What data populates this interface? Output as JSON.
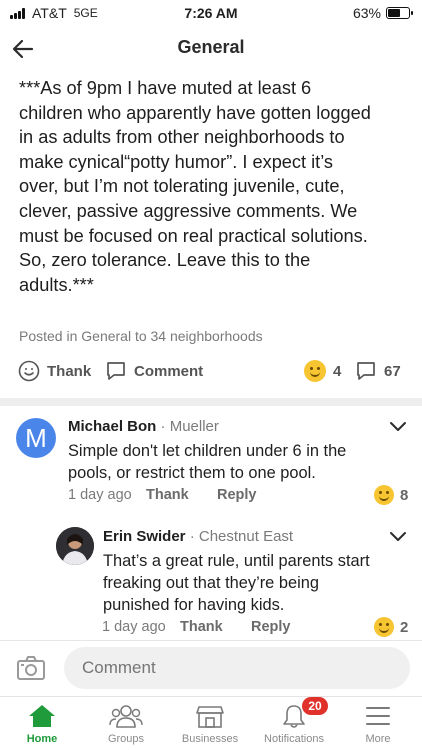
{
  "status_bar": {
    "carrier": "AT&T",
    "network": "5GE",
    "time": "7:26 AM",
    "battery": "63%",
    "battery_level": 0.63
  },
  "header": {
    "title": "General"
  },
  "post": {
    "text": "***As of 9pm I have muted at least 6\nchildren who apparently have gotten logged\nin as adults from other neighborhoods to\nmake cynical“potty humor”.  I expect it’s\nover, but I’m not tolerating juvenile, cute,\nclever, passive aggressive comments. We\nmust be focused on real practical solutions.\nSo, zero tolerance. Leave this to the\nadults.***",
    "meta": "Posted in General to 34 neighborhoods",
    "thank_label": "Thank",
    "comment_label": "Comment",
    "reaction_count": "4",
    "comment_count": "67"
  },
  "comments": [
    {
      "avatar_letter": "M",
      "avatar_color": "#4a86ea",
      "name": "Michael Bon",
      "neighborhood": "· Mueller",
      "body": "Simple don't let children under 6 in the\npools, or restrict them to one pool.",
      "time": "1 day ago",
      "thank_label": "Thank",
      "reply_label": "Reply",
      "reaction_count": "8"
    },
    {
      "name": "Erin Swider",
      "neighborhood": "· Chestnut East",
      "body": "That’s a great rule, until parents start\nfreaking out that they’re being\npunished for having kids.",
      "time": "1 day ago",
      "thank_label": "Thank",
      "reply_label": "Reply",
      "reaction_count": "2"
    }
  ],
  "composer": {
    "placeholder": "Comment"
  },
  "tabbar": {
    "tabs": [
      {
        "label": "Home",
        "icon": "home-icon",
        "active": true
      },
      {
        "label": "Groups",
        "icon": "groups-icon"
      },
      {
        "label": "Businesses",
        "icon": "businesses-icon"
      },
      {
        "label": "Notifications",
        "icon": "bell-icon",
        "badge": "20"
      },
      {
        "label": "More",
        "icon": "menu-icon"
      }
    ]
  },
  "colors": {
    "accent_green": "#1f9b3c",
    "badge_red": "#e0312a",
    "emoji_yellow": "#f6c531"
  }
}
